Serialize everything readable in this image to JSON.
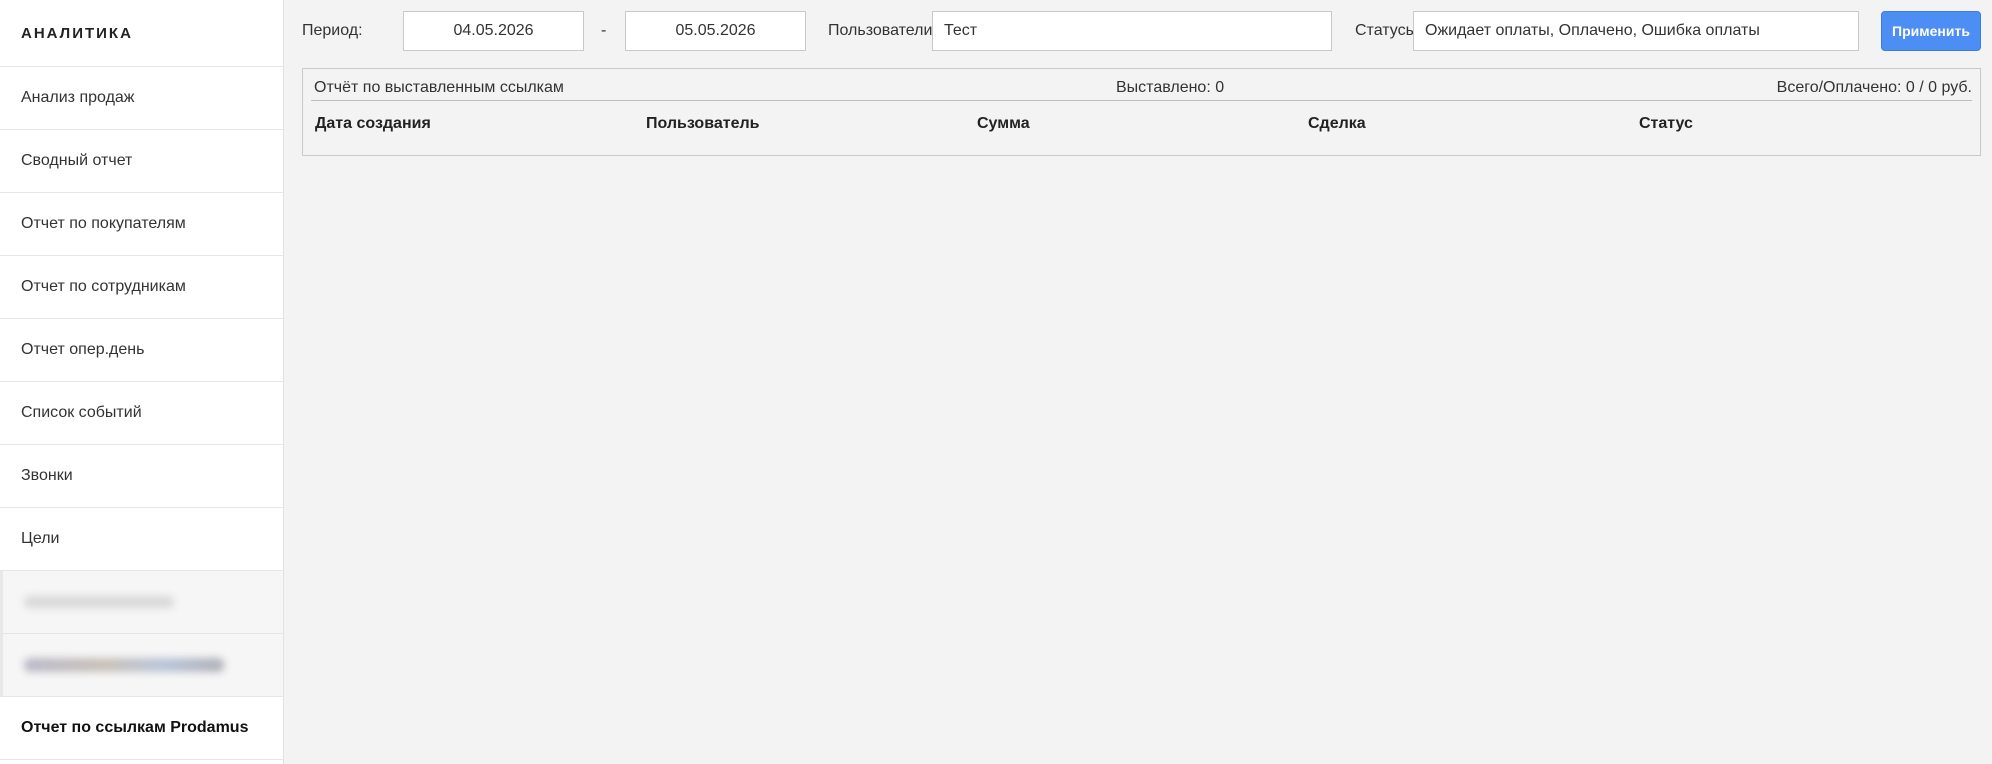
{
  "sidebar": {
    "title": "АНАЛИТИКА",
    "items": [
      {
        "label": "Анализ продаж"
      },
      {
        "label": "Сводный отчет"
      },
      {
        "label": "Отчет по покупателям"
      },
      {
        "label": "Отчет по сотрудникам"
      },
      {
        "label": "Отчет опер.день"
      },
      {
        "label": "Список событий"
      },
      {
        "label": "Звонки"
      },
      {
        "label": "Цели"
      }
    ],
    "active_item": {
      "label": "Отчет по ссылкам Prodamus"
    }
  },
  "filters": {
    "period_label": "Период:",
    "date_from": "04.05.2026",
    "date_separator": "-",
    "date_to": "05.05.2026",
    "users_label": "Пользователи",
    "users_value": "Тест",
    "statuses_label": "Статусы",
    "statuses_value": "Ожидает оплаты, Оплачено, Ошибка оплаты",
    "apply_label": "Применить"
  },
  "report": {
    "title": "Отчёт по выставленным ссылкам",
    "issued": "Выставлено: 0",
    "total_paid": "Всего/Оплачено: 0 / 0 руб.",
    "columns": [
      "Дата создания",
      "Пользователь",
      "Сумма",
      "Сделка",
      "Статус"
    ]
  },
  "colors": {
    "accent": "#4c8ef3",
    "background": "#f3f3f3",
    "sidebar_bg": "#ffffff"
  }
}
